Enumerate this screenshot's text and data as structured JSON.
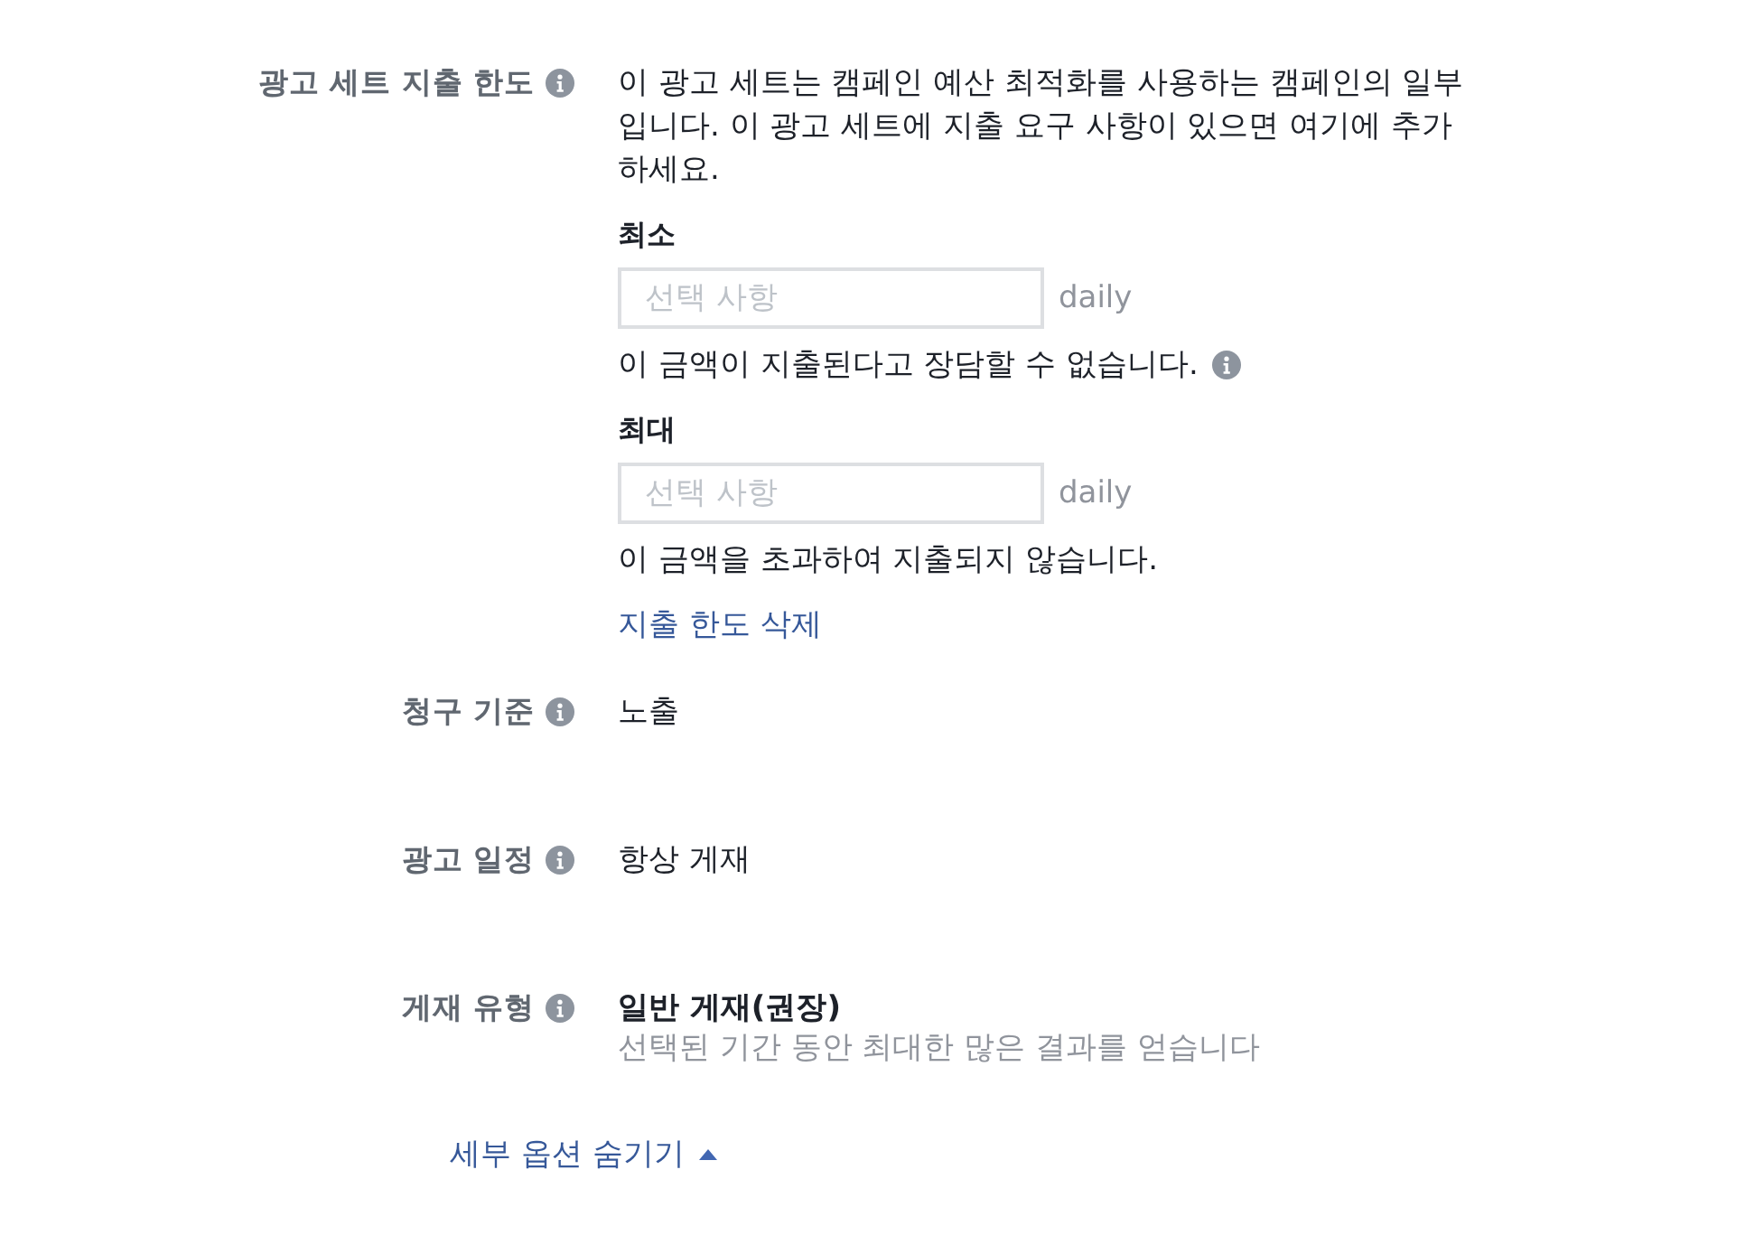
{
  "rows": [
    {
      "kind": "spend_limit",
      "label": "광고 세트 지출 한도",
      "description": "이 광고 세트는 캠페인 예산 최적화를 사용하는 캠페인의 일부입니다. 이 광고 세트에 지출 요구 사항이 있으면 여기에 추가하세요.",
      "limits": [
        {
          "label": "최소",
          "placeholder": "선택 사항",
          "unit": "daily",
          "note": "이 금액이 지출된다고 장담할 수 없습니다.",
          "info": true
        },
        {
          "label": "최대",
          "placeholder": "선택 사항",
          "unit": "daily",
          "note": "이 금액을 초과하여 지출되지 않습니다.",
          "info": false
        }
      ],
      "link": "지출 한도 삭제"
    },
    {
      "kind": "text",
      "label": "청구 기준",
      "value": "노출"
    },
    {
      "kind": "text",
      "label": "광고 일정",
      "value": "항상 게재"
    },
    {
      "kind": "option",
      "label": "게재 유형",
      "value": "일반 게재(권장)",
      "detail": "선택된 기간 동안 최대한 많은 결과를 얻습니다"
    }
  ],
  "toggle": {
    "label": "세부 옵션 숨기기",
    "expanded": true
  }
}
